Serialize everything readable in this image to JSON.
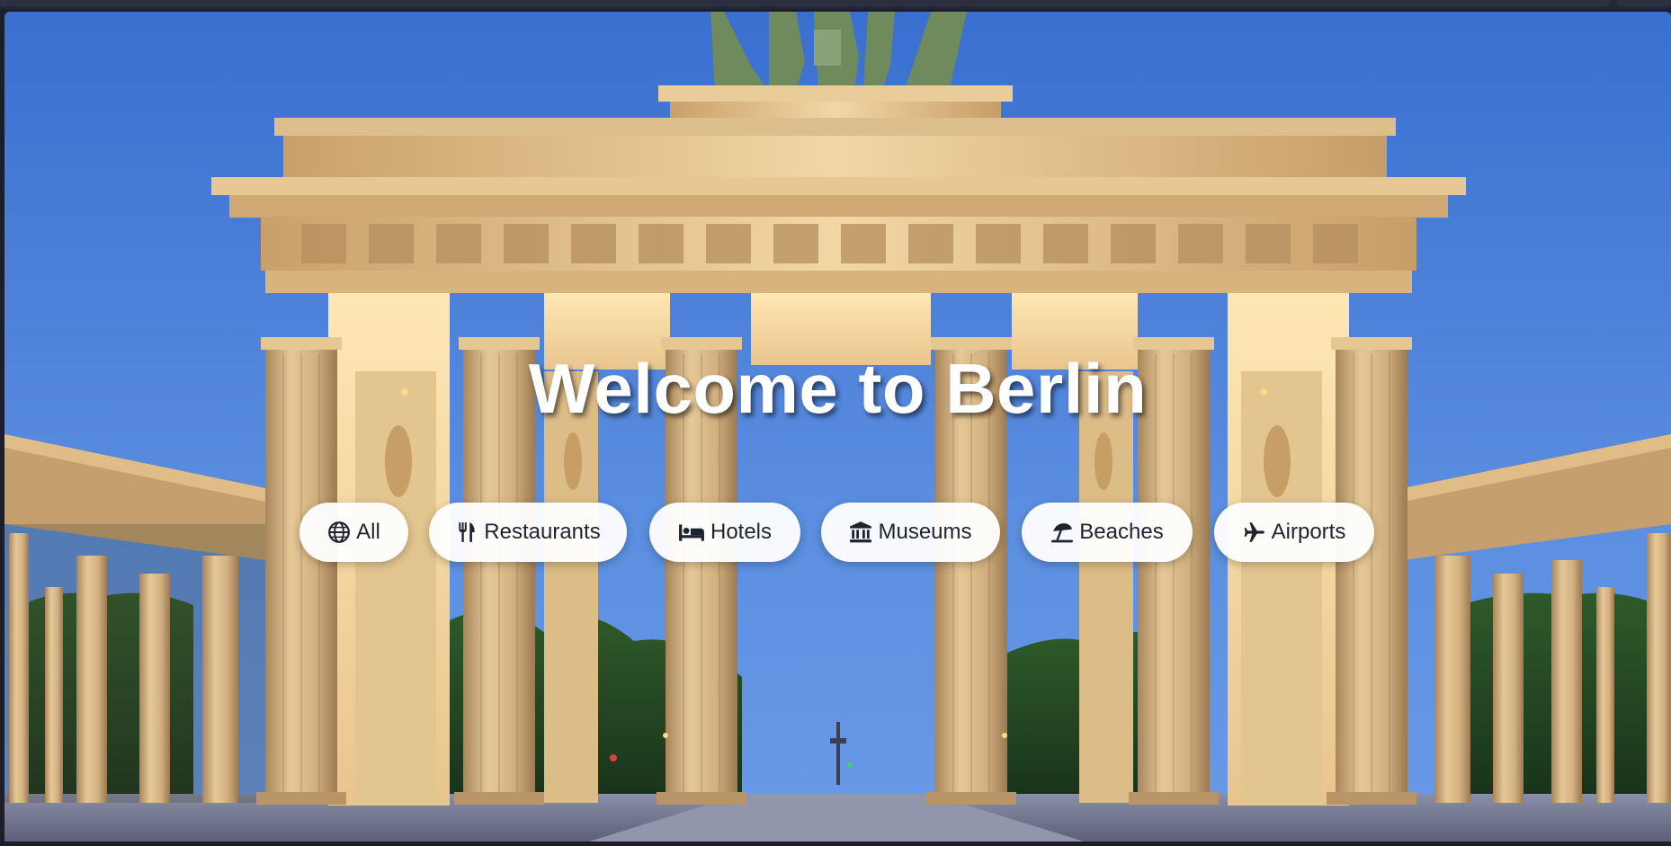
{
  "hero": {
    "title": "Welcome to Berlin",
    "image_subject": "Brandenburg Gate at dusk"
  },
  "filters": [
    {
      "label": "All",
      "icon": "globe-icon"
    },
    {
      "label": "Restaurants",
      "icon": "utensils-icon"
    },
    {
      "label": "Hotels",
      "icon": "bed-icon"
    },
    {
      "label": "Museums",
      "icon": "landmark-icon"
    },
    {
      "label": "Beaches",
      "icon": "umbrella-beach-icon"
    },
    {
      "label": "Airports",
      "icon": "plane-icon"
    }
  ],
  "colors": {
    "sky_top": "#3a6fd0",
    "sky_bottom": "#6b98e4",
    "stone_light": "#f3d9a6",
    "stone_mid": "#d9b27a",
    "chip_bg": "#ffffff",
    "chip_text": "#1f2330"
  }
}
